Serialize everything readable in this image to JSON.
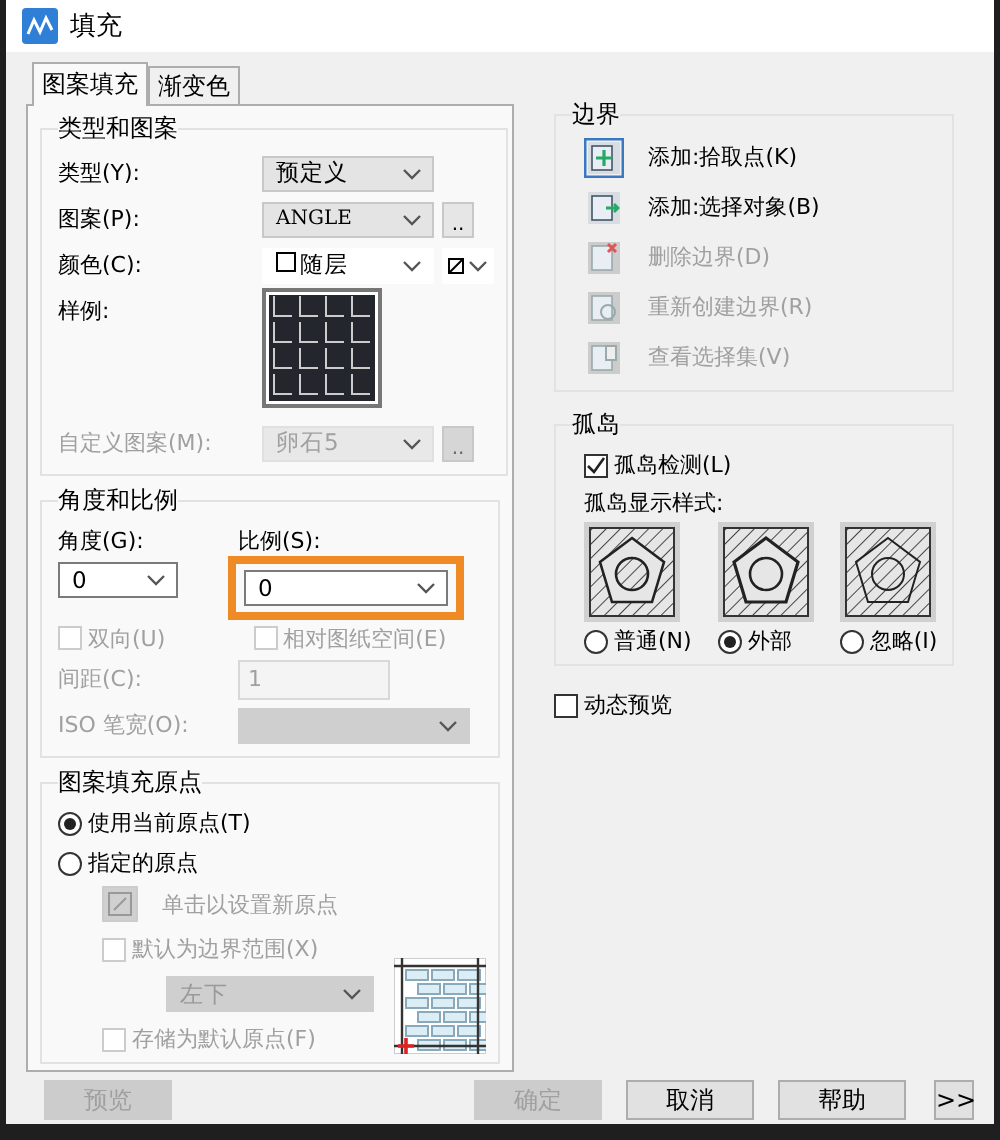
{
  "window": {
    "title": "填充"
  },
  "tabs": [
    {
      "label": "图案填充",
      "selected": true
    },
    {
      "label": "渐变色",
      "selected": false
    }
  ],
  "type_pattern": {
    "title": "类型和图案",
    "type": {
      "label": "类型(Y):",
      "value": "预定义"
    },
    "pattern": {
      "label": "图案(P):",
      "value": "ANGLE",
      "button": ".."
    },
    "color": {
      "label": "颜色(C):",
      "value": "随层"
    },
    "sample": {
      "label": "样例:"
    },
    "custom": {
      "label": "自定义图案(M):",
      "value": "卵石5",
      "button": "..",
      "disabled": true
    }
  },
  "angle_scale": {
    "title": "角度和比例",
    "angle": {
      "label": "角度(G):",
      "value": "0"
    },
    "scale": {
      "label": "比例(S):",
      "value": "0",
      "highlighted": true
    },
    "double": {
      "label": "双向(U)",
      "checked": false,
      "disabled": true
    },
    "relative": {
      "label": "相对图纸空间(E)",
      "checked": false,
      "disabled": true
    },
    "spacing": {
      "label": "间距(C):",
      "value": "1",
      "disabled": true
    },
    "iso": {
      "label": "ISO 笔宽(O):",
      "disabled": true
    }
  },
  "origin": {
    "title": "图案填充原点",
    "options": [
      {
        "label": "使用当前原点(T)",
        "selected": true
      },
      {
        "label": "指定的原点",
        "selected": false
      }
    ],
    "set_button": {
      "label": "单击以设置新原点",
      "disabled": true
    },
    "default_extent": {
      "label": "默认为边界范围(X)",
      "checked": false,
      "disabled": true
    },
    "position": {
      "value": "左下",
      "disabled": true
    },
    "store": {
      "label": "存储为默认原点(F)",
      "checked": false,
      "disabled": true
    }
  },
  "boundary": {
    "title": "边界",
    "actions": [
      {
        "label": "添加:拾取点(K)",
        "disabled": false
      },
      {
        "label": "添加:选择对象(B)",
        "disabled": false
      },
      {
        "label": "删除边界(D)",
        "disabled": true
      },
      {
        "label": "重新创建边界(R)",
        "disabled": true
      },
      {
        "label": "查看选择集(V)",
        "disabled": true
      }
    ]
  },
  "islands": {
    "title": "孤岛",
    "detect": {
      "label": "孤岛检测(L)",
      "checked": true
    },
    "style_label": "孤岛显示样式:",
    "styles": [
      {
        "label": "普通(N)",
        "selected": false
      },
      {
        "label": "外部",
        "selected": true
      },
      {
        "label": "忽略(I)",
        "selected": false
      }
    ]
  },
  "dynamic_preview": {
    "label": "动态预览",
    "checked": false
  },
  "buttons": [
    {
      "label": "预览",
      "disabled": true
    },
    {
      "label": "确定",
      "disabled": true
    },
    {
      "label": "取消",
      "disabled": false
    },
    {
      "label": "帮助",
      "disabled": false
    },
    {
      "label": ">>",
      "disabled": false
    }
  ]
}
